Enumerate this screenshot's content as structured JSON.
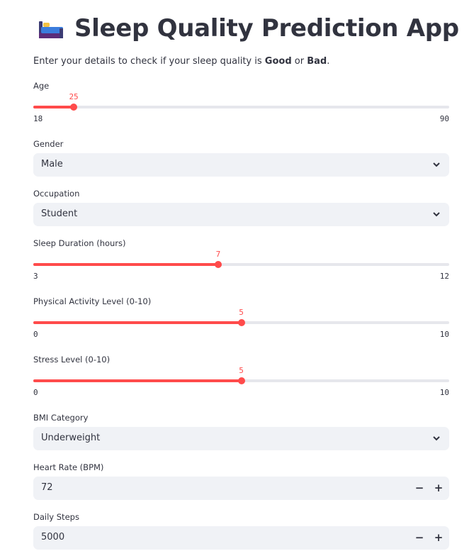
{
  "header": {
    "icon": "bed-icon",
    "title": "Sleep Quality Prediction App"
  },
  "subtitle": {
    "prefix": "Enter your details to check if your sleep quality is ",
    "good": "Good",
    "middle": " or ",
    "bad": "Bad",
    "suffix": "."
  },
  "age": {
    "label": "Age",
    "min": 18,
    "max": 90,
    "value": 25
  },
  "gender": {
    "label": "Gender",
    "value": "Male"
  },
  "occupation": {
    "label": "Occupation",
    "value": "Student"
  },
  "sleep_duration": {
    "label": "Sleep Duration (hours)",
    "min": 3,
    "max": 12,
    "value": 7
  },
  "physical_activity": {
    "label": "Physical Activity Level (0-10)",
    "min": 0,
    "max": 10,
    "value": 5
  },
  "stress": {
    "label": "Stress Level (0-10)",
    "min": 0,
    "max": 10,
    "value": 5
  },
  "bmi": {
    "label": "BMI Category",
    "value": "Underweight"
  },
  "heart_rate": {
    "label": "Heart Rate (BPM)",
    "value": "72",
    "minus": "−",
    "plus": "+"
  },
  "daily_steps": {
    "label": "Daily Steps",
    "value": "5000",
    "minus": "−",
    "plus": "+"
  },
  "colors": {
    "accent": "#ff4b4b",
    "input_bg": "#f0f2f6",
    "text": "#31333f"
  }
}
